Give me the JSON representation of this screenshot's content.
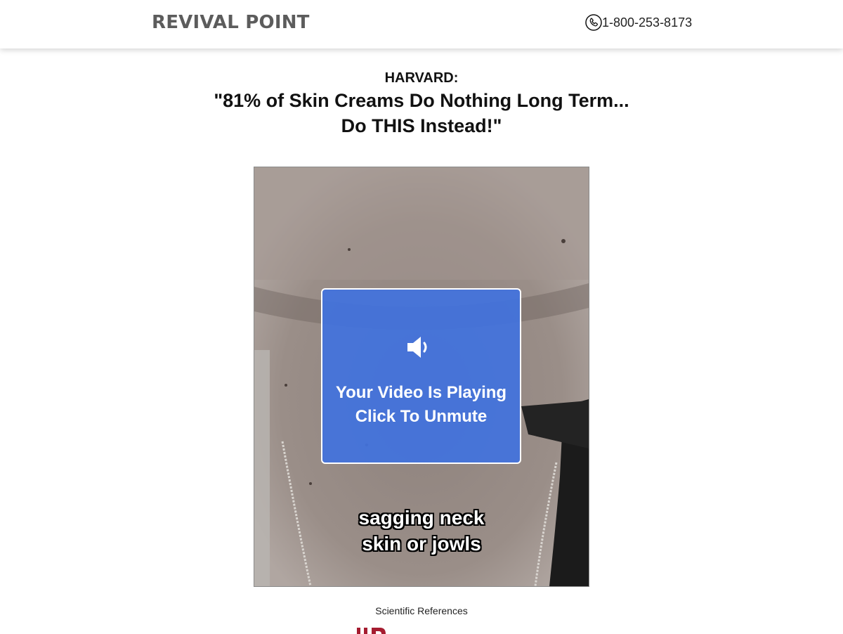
{
  "header": {
    "logo_text": "REVIVAL POINT",
    "phone_number": "1-800-253-8173",
    "phone_icon": "phone-icon"
  },
  "headline": {
    "kicker": "HARVARD:",
    "title": "\"81% of Skin Creams Do Nothing Long Term... Do THIS Instead!\""
  },
  "video": {
    "overlay_icon": "speaker-icon",
    "overlay_line1": "Your Video Is Playing",
    "overlay_line2": "Click To Unmute",
    "caption_line1": "sagging neck",
    "caption_line2": "skin or jowls",
    "overlay_color": "#4272de"
  },
  "references": {
    "label": "Scientific References",
    "partial_logo_color": "#a51c30"
  }
}
